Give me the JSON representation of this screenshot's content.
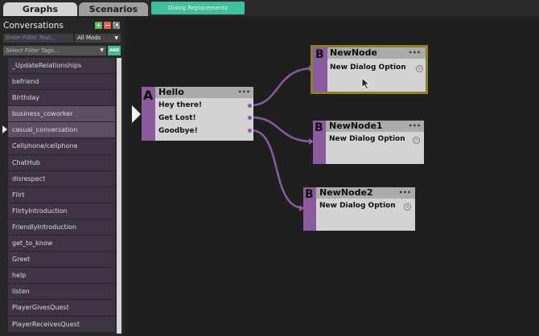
{
  "tabs": {
    "graphs": "Graphs",
    "scenarios": "Scenarios",
    "dialog_replacements": "Dialog Replacements"
  },
  "sidebar": {
    "title": "Conversations",
    "add_icon": "+",
    "remove_icon": "−",
    "filter_placeholder": "Enter Filter Text...",
    "mods_value": "All Mods",
    "tags_placeholder": "Select Filter Tags...",
    "and_label": "AND",
    "items": [
      "_UpdateRelationships",
      "befriend",
      "Birthday",
      "business_coworker",
      "casual_conversation",
      "Cellphone/cellphone",
      "ChatHub",
      "disrespect",
      "Flirt",
      "FlirtyIntroduction",
      "FriendlyIntroduction",
      "get_to_know",
      "Greet",
      "help",
      "listen",
      "PlayerGivesQuest",
      "PlayerReceivesQuest"
    ],
    "selected_index": 4
  },
  "graph": {
    "node_a": {
      "letter": "A",
      "title": "Hello",
      "dots": "•••",
      "options": [
        "Hey there!",
        "Get Lost!",
        "Goodbye!"
      ]
    },
    "node_b1": {
      "letter": "B",
      "title": "NewNode",
      "dots": "•••",
      "option": "New Dialog Option"
    },
    "node_b2": {
      "letter": "B",
      "title": "NewNode1",
      "dots": "•••",
      "option": "New Dialog Option"
    },
    "node_b3": {
      "letter": "B",
      "title": "NewNode2",
      "dots": "•••",
      "option": "New Dialog Option"
    },
    "close_glyph": "×"
  },
  "colors": {
    "accent_purple": "#8a5c9e",
    "teal": "#3fbf9b",
    "selected_border": "#8e7e2e",
    "canvas": "#1f1f1f"
  }
}
